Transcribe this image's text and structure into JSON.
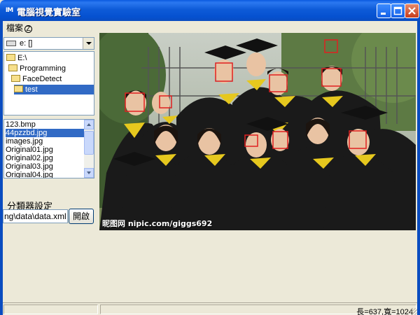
{
  "window": {
    "title": "電腦視覺實驗室",
    "icon": "app-icon",
    "icon_text": "IM",
    "title_bar_color": "#0a5ae0"
  },
  "menu": {
    "file_label": "檔案",
    "file_accelerator": "Z"
  },
  "drive": {
    "selected": "e: []",
    "icon": "drive-icon"
  },
  "directories": [
    {
      "label": "E:\\",
      "level": 0
    },
    {
      "label": "Programming",
      "level": 1
    },
    {
      "label": "FaceDetect",
      "level": 2
    },
    {
      "label": "test",
      "level": 3,
      "selected": true
    }
  ],
  "files": [
    {
      "label": "123.bmp"
    },
    {
      "label": "44pzzbd.jpg",
      "selected": true
    },
    {
      "label": "images.jpg"
    },
    {
      "label": "Original01.jpg"
    },
    {
      "label": "Original02.jpg"
    },
    {
      "label": "Original03.jpg"
    },
    {
      "label": "Original04.jpg"
    }
  ],
  "classifier": {
    "label": "分類器設定",
    "path_value": "ng\\data\\data.xml",
    "open_button": "開啟"
  },
  "photo": {
    "watermark": "昵图网 nipic.com/giggs692",
    "detection_box_color": "#e02020"
  },
  "status": {
    "dimensions_text": "長=637,寬=1024"
  },
  "selection_color": "#316ac5"
}
